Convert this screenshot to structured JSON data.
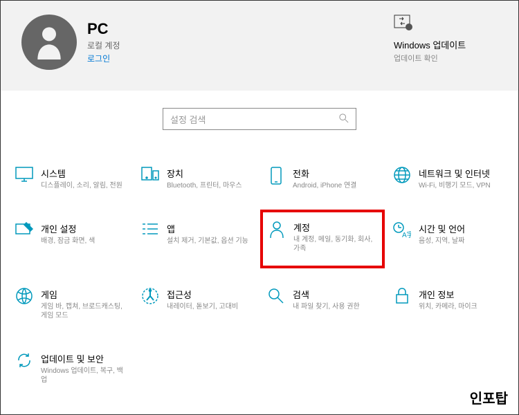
{
  "header": {
    "user_title": "PC",
    "user_sub": "로컬 계정",
    "signin_label": "로그인",
    "update_title": "Windows 업데이트",
    "update_sub": "업데이트 확인"
  },
  "search": {
    "placeholder": "설정 검색"
  },
  "tiles": {
    "system": {
      "title": "시스템",
      "desc": "디스플레이, 소리, 알림, 전원"
    },
    "devices": {
      "title": "장치",
      "desc": "Bluetooth, 프린터, 마우스"
    },
    "phone": {
      "title": "전화",
      "desc": "Android, iPhone 연결"
    },
    "network": {
      "title": "네트워크 및 인터넷",
      "desc": "Wi-Fi, 비행기 모드, VPN"
    },
    "personalization": {
      "title": "개인 설정",
      "desc": "배경, 잠금 화면, 색"
    },
    "apps": {
      "title": "앱",
      "desc": "설치 제거, 기본값, 옵션 기능"
    },
    "accounts": {
      "title": "계정",
      "desc": "내 계정, 메일, 동기화, 회사, 가족"
    },
    "time": {
      "title": "시간 및 언어",
      "desc": "음성, 지역, 날짜"
    },
    "gaming": {
      "title": "게임",
      "desc": "게임 바, 캡쳐, 브로드캐스팅, 게임 모드"
    },
    "ease": {
      "title": "접근성",
      "desc": "내레이터, 돋보기, 고대비"
    },
    "search_tile": {
      "title": "검색",
      "desc": "내 파일 찾기, 사용 권한"
    },
    "privacy": {
      "title": "개인 정보",
      "desc": "위치, 카메라, 마이크"
    },
    "update": {
      "title": "업데이트 및 보안",
      "desc": "Windows 업데이트, 복구, 백업"
    }
  },
  "watermark": "인포탑"
}
